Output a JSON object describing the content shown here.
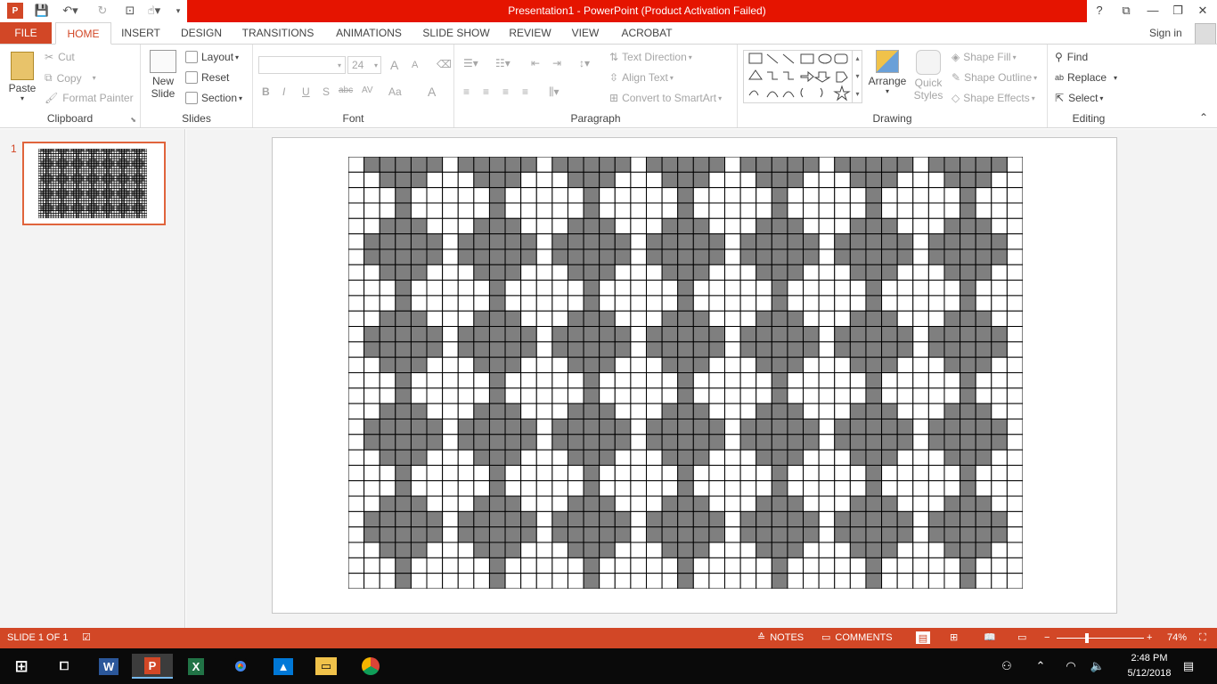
{
  "title": {
    "window_title": "Presentation1 - PowerPoint (Product Activation Failed)",
    "help": "?",
    "restore_ribbon": "⧉",
    "minimize": "—",
    "maximize": "❐",
    "close": "✕"
  },
  "tabs": [
    "FILE",
    "HOME",
    "INSERT",
    "DESIGN",
    "TRANSITIONS",
    "ANIMATIONS",
    "SLIDE SHOW",
    "REVIEW",
    "VIEW",
    "ACROBAT"
  ],
  "account": {
    "sign_in": "Sign in"
  },
  "ribbon": {
    "clipboard": {
      "paste": "Paste",
      "cut": "Cut",
      "copy": "Copy",
      "format_painter": "Format Painter",
      "label": "Clipboard"
    },
    "slides": {
      "new_slide_1": "New",
      "new_slide_2": "Slide",
      "layout": "Layout",
      "reset": "Reset",
      "section": "Section",
      "label": "Slides"
    },
    "font": {
      "font_size": "24",
      "label": "Font",
      "bold": "B",
      "italic": "I",
      "underline": "U",
      "shadow": "S",
      "strike": "abc",
      "spacing": "AV",
      "case": "Aa",
      "color": "A",
      "grow": "A",
      "shrink": "A"
    },
    "paragraph": {
      "text_direction": "Text Direction",
      "align_text": "Align Text",
      "convert_smartart": "Convert to SmartArt",
      "label": "Paragraph"
    },
    "drawing": {
      "arrange": "Arrange",
      "quick_styles_1": "Quick",
      "quick_styles_2": "Styles",
      "shape_fill": "Shape Fill",
      "shape_outline": "Shape Outline",
      "shape_effects": "Shape Effects",
      "label": "Drawing"
    },
    "editing": {
      "find": "Find",
      "replace": "Replace",
      "select": "Select",
      "label": "Editing"
    }
  },
  "slides_pane": {
    "number": "1"
  },
  "slide_grid": {
    "rows": 28,
    "cols": 43,
    "filled_color": "#7f7f7f",
    "empty_color": "#ffffff",
    "pattern_period_rows": 12,
    "pattern_period_cols": 12
  },
  "status": {
    "slide_info": "SLIDE 1 OF 1",
    "notes": "NOTES",
    "comments": "COMMENTS",
    "zoom": "74%"
  },
  "taskbar": {
    "time": "2:48 PM",
    "date": "5/12/2018"
  }
}
